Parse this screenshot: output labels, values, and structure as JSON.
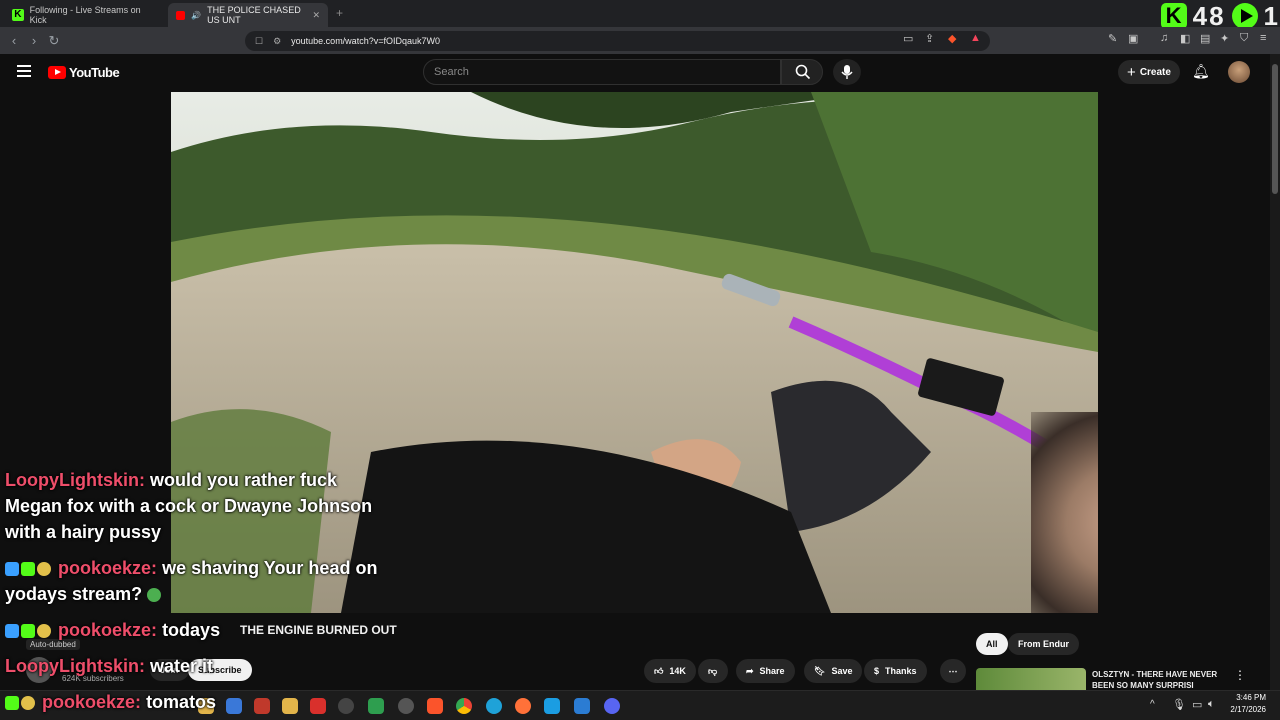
{
  "browser": {
    "tabs": [
      {
        "title": "Following - Live Streams on Kick"
      },
      {
        "title": "THE POLICE CHASED US UNT"
      }
    ],
    "url": "youtube.com/watch?v=fOIDqauk7W0",
    "new_tab_glyph": "+",
    "close_glyph": "✕"
  },
  "kick_overlay": {
    "logo": "K",
    "viewers_a": "48",
    "viewers_b": "1"
  },
  "youtube": {
    "logo_text": "YouTube",
    "search_placeholder": "Search",
    "create_label": "Create",
    "video_title": "THE ENGINE BURNED OUT",
    "auto_dubbed": "Auto-dubbed",
    "subscribers": "624K subscribers",
    "join_label": "Join",
    "subscribe_label": "Subscribe",
    "likes": "14K",
    "share_label": "Share",
    "save_label": "Save",
    "thanks_label": "Thanks",
    "filter_all": "All",
    "filter_from": "From Endur",
    "recommended_title_1": "OLSZTYN - THERE HAVE NEVER",
    "recommended_title_2": "BEEN SO MANY SURPRISI"
  },
  "chat": [
    {
      "user": "LoopyLightskin:",
      "text": "would you rather fuck",
      "text2": "Megan fox with a cock or Dwayne Johnson",
      "text3": "with a hairy pussy"
    },
    {
      "user": "pookoekze:",
      "text": "we shaving Your head on",
      "text2": "yodays stream?"
    },
    {
      "user": "pookoekze:",
      "text": "todays"
    },
    {
      "user": "LoopyLightskin:",
      "text": "water it"
    },
    {
      "user": "pookoekze:",
      "text": "tomatos"
    }
  ],
  "taskbar": {
    "time": "3:46 PM",
    "date": "2/17/2026"
  },
  "colors": {
    "kick_green": "#53fc18",
    "yt_red": "#ff0000",
    "chat_user": "#ee4e6a"
  }
}
